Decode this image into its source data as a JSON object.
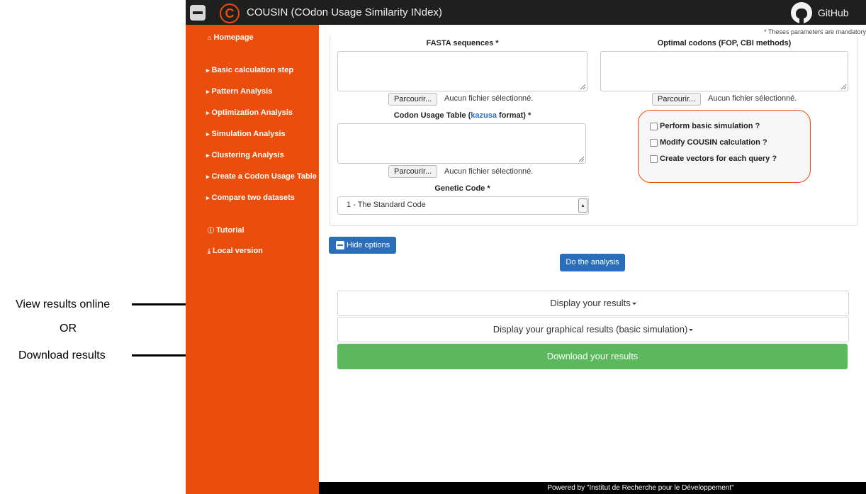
{
  "annotations": {
    "view_online": "View results online",
    "or": "OR",
    "download": "Download results"
  },
  "app": {
    "title": "COUSIN (COdon Usage Similarity INdex)",
    "logo_letter": "C",
    "github_label": "GitHub"
  },
  "sidebar": {
    "homepage": "Homepage",
    "items": [
      "Basic calculation step",
      "Pattern Analysis",
      "Optimization Analysis",
      "Simulation Analysis",
      "Clustering Analysis",
      "Create a Codon Usage Table",
      "Compare two datasets"
    ],
    "tutorial": "Tutorial",
    "local_version": "Local version"
  },
  "form": {
    "mandatory_note": "* Theses parameters are mandatory",
    "fasta_label": "FASTA sequences *",
    "optimal_label": "Optimal codons (FOP, CBI methods)",
    "cu_label_prefix": "Codon Usage Table (",
    "cu_label_link": "kazusa",
    "cu_label_suffix": " format) *",
    "browse_label": "Parcourir...",
    "no_file": "Aucun fichier sélectionné.",
    "genetic_code_label": "Genetic Code *",
    "genetic_code_value": "1 - The Standard Code",
    "options": [
      "Perform basic simulation ?",
      "Modify COUSIN calculation ?",
      "Create vectors for each query ?"
    ]
  },
  "actions": {
    "hide_options": "Hide options",
    "do_analysis": "Do the analysis",
    "display_results": "Display your results",
    "display_graphical": "Display your graphical results (basic simulation)",
    "download": "Download your results"
  },
  "footer": "Powered by \"Institut de Recherche pour le Développement\"",
  "colors": {
    "sidebar": "#ea4d0c",
    "topbar": "#1f1f1f",
    "primary": "#2a6ebb",
    "success": "#5cb85c"
  }
}
